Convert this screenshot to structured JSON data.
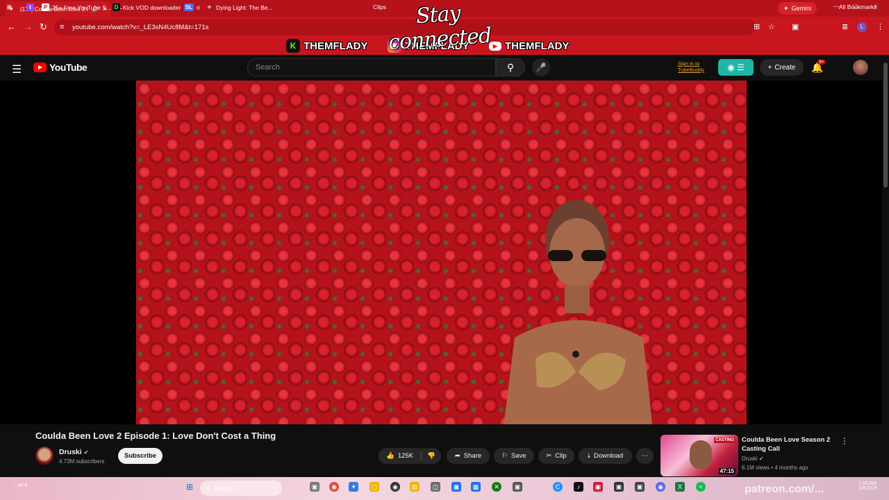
{
  "browser": {
    "tab_title": "(174) Coulda Been Love 2 E",
    "tab_favicon": "youtube-icon",
    "overlay_text": "Stay connected",
    "gemini_label": "Gemini",
    "url": "youtube.com/watch?v=_LE3sN4Uc8M&t=171s",
    "all_bookmarks": "All Bookmarks",
    "bookmarks": [
      {
        "label": "",
        "icon": "twitch-icon"
      },
      {
        "label": "25+ Free YouTube S...",
        "icon": "page-icon"
      },
      {
        "label": "Kick VOD downloader",
        "icon": "kick-icon"
      },
      {
        "label": "ri",
        "icon": "sl-icon"
      },
      {
        "label": "Dying Light: The Be...",
        "icon": "game-icon"
      },
      {
        "label": "Clips",
        "icon": "clips-icon"
      }
    ],
    "brand_tags": [
      "THEMFLADY",
      "THEMFLADY",
      "THEMFLADY"
    ],
    "accent_color": "#c8161f"
  },
  "youtube": {
    "logo_text": "YouTube",
    "search_placeholder": "Search",
    "tubebuddy_line1": "Sign in to",
    "tubebuddy_line2": "TubeBuddy",
    "create_label": "Create",
    "notif_badge": "9+"
  },
  "video": {
    "title": "Coulda Been Love 2 Episode 1: Love Don't Cost a Thing",
    "channel": "Druski",
    "subscribers": "4.73M subscribers",
    "subscribe_label": "Subscribe",
    "likes": "125K",
    "share_label": "Share",
    "save_label": "Save",
    "clip_label": "Clip",
    "download_label": "Download"
  },
  "recommended": {
    "title": "Coulda Been Love Season 2 Casting Call",
    "channel": "Druski",
    "meta": "6.1M views • 4 months ago",
    "duration": "47:15",
    "badge": "CASTING"
  },
  "taskbar": {
    "weather": "40°F",
    "weather_sub": "Clear",
    "search_label": "Search",
    "time": "1:06 AM",
    "date": "2/4/2025",
    "watermark": "patreon.com/..."
  }
}
